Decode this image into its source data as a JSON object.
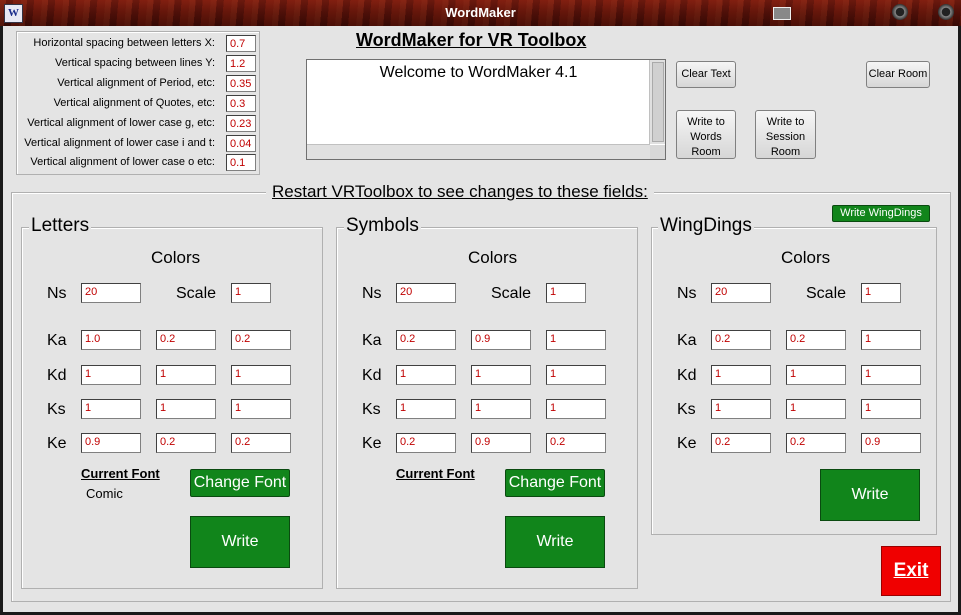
{
  "window": {
    "title": "WordMaker",
    "app_icon": "W"
  },
  "spacing": [
    {
      "label": "Horizontal spacing between letters  X:",
      "value": "0.7"
    },
    {
      "label": "Vertical spacing between lines  Y:",
      "value": "1.2"
    },
    {
      "label": "Vertical alignment of Period, etc:",
      "value": "0.35"
    },
    {
      "label": "Vertical alignment of Quotes, etc:",
      "value": "0.3"
    },
    {
      "label": "Vertical alignment of lower case g, etc:",
      "value": "0.23"
    },
    {
      "label": "Vertical alignment of lower case i and t:",
      "value": "0.04"
    },
    {
      "label": "Vertical alignment of lower case o etc:",
      "value": "0.1"
    }
  ],
  "header": {
    "title": "WordMaker for VR Toolbox",
    "welcome_text": "Welcome to WordMaker 4.1"
  },
  "buttons": {
    "clear_text": "Clear Text",
    "clear_room": "Clear Room",
    "write_words_room": "Write to Words Room",
    "write_session_room": "Write to Session Room",
    "write_wingdings": "Write WingDings",
    "exit": "Exit"
  },
  "restart_notice": "Restart VRToolbox to see changes to these fields:",
  "labels": {
    "colors": "Colors",
    "ns": "Ns",
    "scale": "Scale",
    "ka": "Ka",
    "kd": "Kd",
    "ks": "Ks",
    "ke": "Ke"
  },
  "panels": {
    "letters": {
      "title": "Letters",
      "ns": "20",
      "scale": "1",
      "ka": [
        "1.0",
        "0.2",
        "0.2"
      ],
      "kd": [
        "1",
        "1",
        "1"
      ],
      "ks": [
        "1",
        "1",
        "1"
      ],
      "ke": [
        "0.9",
        "0.2",
        "0.2"
      ],
      "current_font_label": "Current Font",
      "current_font": "Comic",
      "change_font": "Change Font",
      "write": "Write"
    },
    "symbols": {
      "title": "Symbols",
      "ns": "20",
      "scale": "1",
      "ka": [
        "0.2",
        "0.9",
        "1"
      ],
      "kd": [
        "1",
        "1",
        "1"
      ],
      "ks": [
        "1",
        "1",
        "1"
      ],
      "ke": [
        "0.2",
        "0.9",
        "0.2"
      ],
      "current_font_label": "Current Font",
      "change_font": "Change Font",
      "write": "Write"
    },
    "wingdings": {
      "title": "WingDings",
      "ns": "20",
      "scale": "1",
      "ka": [
        "0.2",
        "0.2",
        "1"
      ],
      "kd": [
        "1",
        "1",
        "1"
      ],
      "ks": [
        "1",
        "1",
        "1"
      ],
      "ke": [
        "0.2",
        "0.2",
        "0.9"
      ],
      "write": "Write"
    }
  }
}
